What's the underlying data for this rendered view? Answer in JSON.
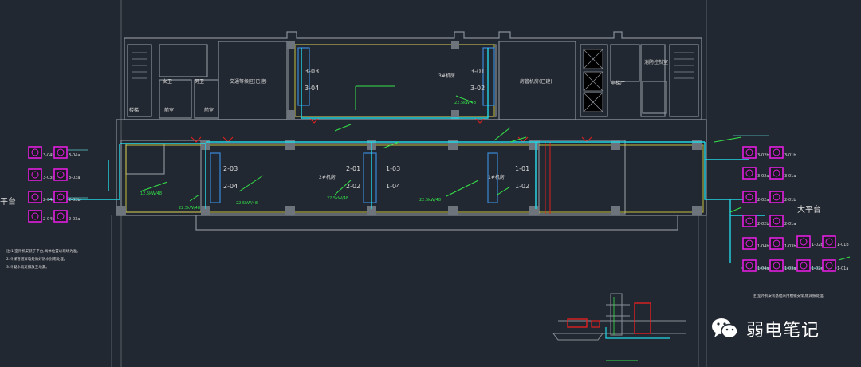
{
  "colors": {
    "background": "#222831",
    "wall": "#8a8f96",
    "pipe": "#22d6e6",
    "annotation": "#34e24a",
    "unit": "#e21ee0",
    "equipment_red": "#e02020",
    "text": "#dcdcdc"
  },
  "rooms": {
    "top_left_stair": "楼梯",
    "top_room_a": "女卫",
    "top_room_b": "男卫",
    "top_room_c": "前室",
    "top_room_d": "前室",
    "corridor_left": "交通等候区(已建)",
    "center_top": "3#机房",
    "corridor_right": "房管机房(已建)",
    "elevator_hall": "电梯厅",
    "fire_room": "消防控制室",
    "main_room": "2#机房",
    "right_room": "1#机房",
    "big_terrace": "大平台",
    "left_terrace": "平台"
  },
  "equipment": {
    "t1": "3-03",
    "t2": "3-04",
    "t3": "3-01",
    "t4": "3-02",
    "m1": "2-03",
    "m2": "2-04",
    "m3": "2-01",
    "m4": "2-02",
    "m5": "1-03",
    "m6": "1-04",
    "m7": "1-01",
    "m8": "1-02"
  },
  "left_units": [
    "3-04b",
    "3-04a",
    "3-03b",
    "3-03a",
    "2-04a",
    "2-03b",
    "2-04b",
    "2-03a"
  ],
  "right_units": [
    "3-02b",
    "3-01b",
    "3-02a",
    "3-01a",
    "2-02a",
    "2-01b",
    "2-02b",
    "2-01a",
    "1-04b",
    "1-03b",
    "1-04a",
    "1-03a",
    "1-02b",
    "1-01b",
    "1-02a",
    "1-01a"
  ],
  "pipe_labels": [
    "12.5kW/48",
    "22.5kW/48",
    "22.5kW/48",
    "22.5kW/48",
    "22.5kW/48",
    "22.5kW/48"
  ],
  "notes": {
    "left": [
      "注:1.室外机安装于平台,具体位置以现场为准。",
      "2.冷媒管道穿墙处做好防水封堵处理。",
      "3.冷凝水就近排放至地漏。"
    ],
    "right": "注:室外机安装基础采用槽钢支架,做减振处理。"
  },
  "watermark": "弱电笔记"
}
